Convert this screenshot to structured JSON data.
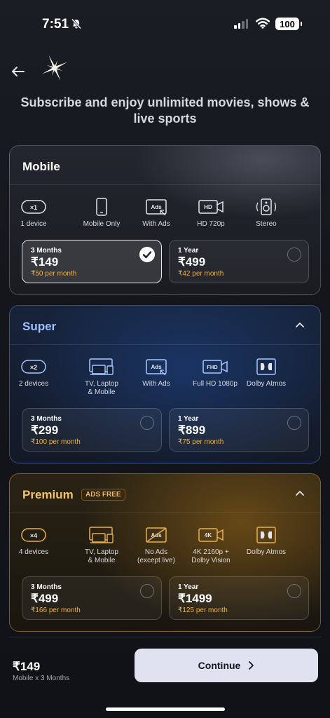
{
  "status": {
    "time": "7:51",
    "battery": "100"
  },
  "header": {
    "headline": "Subscribe and enjoy unlimited movies, shows & live sports"
  },
  "plans": [
    {
      "name": "Mobile",
      "features": [
        {
          "icon": "x1-device-icon",
          "badge": "×1",
          "label": "1 device"
        },
        {
          "icon": "phone-icon",
          "label": "Mobile Only"
        },
        {
          "icon": "ads-icon",
          "badge": "Ads",
          "label": "With Ads"
        },
        {
          "icon": "hd-video-icon",
          "badge": "HD",
          "label": "HD 720p"
        },
        {
          "icon": "speaker-icon",
          "label": "Stereo"
        }
      ],
      "options": [
        {
          "period": "3 Months",
          "price": "₹149",
          "per_month": "₹50 per month",
          "selected": true
        },
        {
          "period": "1 Year",
          "price": "₹499",
          "per_month": "₹42 per month",
          "selected": false
        }
      ]
    },
    {
      "name": "Super",
      "features": [
        {
          "icon": "x2-device-icon",
          "badge": "×2",
          "label": "2 devices"
        },
        {
          "icon": "tv-laptop-mobile-icon",
          "label_l1": "TV, Laptop",
          "label_l2": "& Mobile"
        },
        {
          "icon": "ads-icon",
          "badge": "Ads",
          "label": "With Ads"
        },
        {
          "icon": "fhd-video-icon",
          "badge": "FHD",
          "label": "Full HD 1080p"
        },
        {
          "icon": "dolby-icon",
          "label": "Dolby Atmos"
        }
      ],
      "options": [
        {
          "period": "3 Months",
          "price": "₹299",
          "per_month": "₹100 per month",
          "selected": false
        },
        {
          "period": "1 Year",
          "price": "₹899",
          "per_month": "₹75 per month",
          "selected": false
        }
      ]
    },
    {
      "name": "Premium",
      "badge": "ADS FREE",
      "features": [
        {
          "icon": "x4-device-icon",
          "badge": "×4",
          "label": "4 devices"
        },
        {
          "icon": "tv-laptop-mobile-icon",
          "label_l1": "TV, Laptop",
          "label_l2": "& Mobile"
        },
        {
          "icon": "no-ads-icon",
          "badge": "Ads",
          "label_l1": "No Ads",
          "label_l2": "(except live)"
        },
        {
          "icon": "4k-video-icon",
          "badge": "4K",
          "label_l1": "4K 2160p +",
          "label_l2": "Dolby Vision"
        },
        {
          "icon": "dolby-icon",
          "label": "Dolby Atmos"
        }
      ],
      "options": [
        {
          "period": "3 Months",
          "price": "₹499",
          "per_month": "₹166 per month",
          "selected": false
        },
        {
          "period": "1 Year",
          "price": "₹1499",
          "per_month": "₹125 per month",
          "selected": false
        }
      ]
    }
  ],
  "footer": {
    "total_price": "₹149",
    "total_desc": "Mobile x 3 Months",
    "continue_label": "Continue"
  },
  "colors": {
    "mobile_glow": "#3a3d46",
    "super_blue": "#1d3a6b",
    "premium_gold": "#6b4a16",
    "per_month_text": "#e8b24a"
  }
}
